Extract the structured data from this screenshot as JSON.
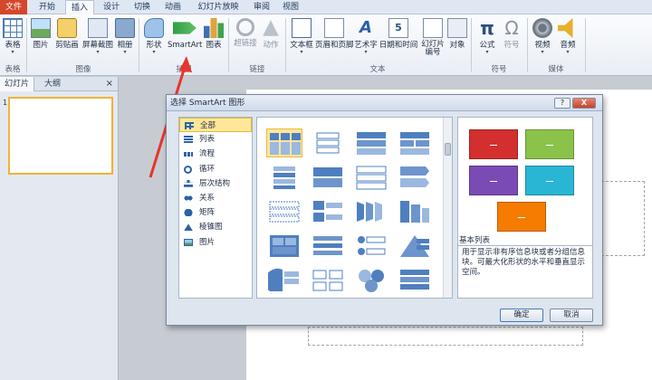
{
  "menu": {
    "tabs": [
      "文件",
      "开始",
      "插入",
      "设计",
      "切换",
      "动画",
      "幻灯片放映",
      "审阅",
      "视图"
    ],
    "active": "插入"
  },
  "ribbon": {
    "groups": {
      "table": "表格",
      "image": "图像",
      "illustration": "插图",
      "links": "链接",
      "text": "文本",
      "symbols": "符号",
      "media": "媒体"
    },
    "buttons": {
      "table": "表格",
      "picture": "图片",
      "clipart": "剪贴画",
      "screenshot": "屏幕截图",
      "album": "相册",
      "shapes": "形状",
      "smartart": "SmartArt",
      "chart": "图表",
      "hyperlink": "超链接",
      "action": "动作",
      "textbox": "文本框",
      "header_footer": "页眉和页脚",
      "wordart": "艺术字",
      "datetime": "日期和时间",
      "slide_number": "幻灯片编号",
      "object": "对象",
      "formula": "公式",
      "symbol": "符号",
      "video": "视频",
      "audio": "音频"
    },
    "icons": {
      "wordart_glyph": "A",
      "formula_glyph": "π",
      "symbol_glyph": "Ω",
      "date_glyph": "5"
    }
  },
  "left_panel": {
    "tabs": [
      "幻灯片",
      "大纲"
    ],
    "close": "×",
    "slide_number": "1"
  },
  "dialog": {
    "title": "选择 SmartArt 图形",
    "help": "?",
    "close": "X",
    "categories": [
      {
        "label": "全部",
        "icon": "grid-icon"
      },
      {
        "label": "列表",
        "icon": "list-icon"
      },
      {
        "label": "流程",
        "icon": "process-icon"
      },
      {
        "label": "循环",
        "icon": "cycle-icon"
      },
      {
        "label": "层次结构",
        "icon": "hierarchy-icon"
      },
      {
        "label": "关系",
        "icon": "relationship-icon"
      },
      {
        "label": "矩阵",
        "icon": "matrix-icon"
      },
      {
        "label": "棱锥图",
        "icon": "pyramid-icon"
      },
      {
        "label": "图片",
        "icon": "picture-icon"
      }
    ],
    "selected_category": "全部",
    "preview_title": "基本列表",
    "description": "用于显示非有序信息块或者分组信息块。可最大化形状的水平和垂直显示空间。",
    "preview_colors": [
      "#d32f2f",
      "#8bc34a",
      "#7b4bb5",
      "#29b6d5",
      "#f57c00"
    ],
    "ok": "确定",
    "cancel": "取消"
  }
}
